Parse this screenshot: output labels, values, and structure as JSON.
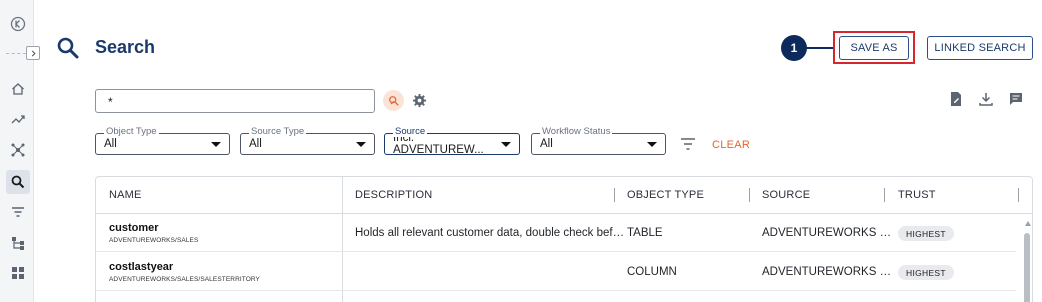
{
  "header": {
    "title": "Search",
    "step_number": "1",
    "save_as_label": "SAVE AS",
    "linked_search_label": "LINKED SEARCH"
  },
  "search": {
    "query": "*"
  },
  "filters": [
    {
      "label": "Object Type",
      "value": "All"
    },
    {
      "label": "Source Type",
      "value": "All"
    },
    {
      "label": "Source",
      "value": "Incl: ADVENTUREW..."
    },
    {
      "label": "Workflow Status",
      "value": "All"
    }
  ],
  "clear_label": "CLEAR",
  "table": {
    "columns": [
      "NAME",
      "DESCRIPTION",
      "OBJECT TYPE",
      "SOURCE",
      "TRUST"
    ],
    "rows": [
      {
        "name": "customer",
        "path": "ADVENTUREWORKS/SALES",
        "description": "Holds all relevant customer data, double check bef…",
        "object_type": "TABLE",
        "source": "ADVENTUREWORKS …",
        "trust": "HIGHEST"
      },
      {
        "name": "costlastyear",
        "path": "ADVENTUREWORKS/SALES/SALESTERRITORY",
        "description": "",
        "object_type": "COLUMN",
        "source": "ADVENTUREWORKS …",
        "trust": "HIGHEST"
      }
    ]
  },
  "colors": {
    "brand_navy": "#1b3a6b",
    "highlight_red": "#d7262e",
    "clear_orange": "#e8652a"
  },
  "icons": {
    "rail": [
      "logo-icon",
      "home-icon",
      "trend-icon",
      "graph-icon",
      "search-icon",
      "filter-icon",
      "hierarchy-icon",
      "dashboard-icon"
    ],
    "toolbar": [
      "edit-document-icon",
      "download-icon",
      "comment-icon"
    ]
  }
}
